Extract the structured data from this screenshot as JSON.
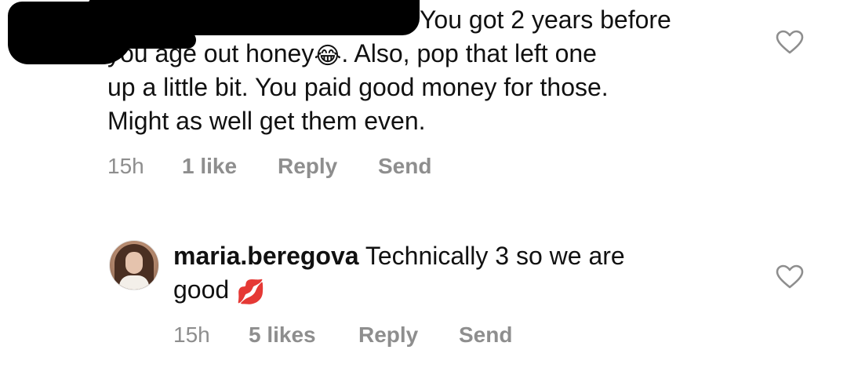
{
  "comments": [
    {
      "username": "",
      "text_line1": "You got 2 years before",
      "text_line2a": "you age out honey",
      "emoji": "😂",
      "text_line2b": ". Also, pop that left one",
      "text_line3": "up a little bit. You paid good money for those.",
      "text_line4": "Might as well get them even.",
      "time": "15h",
      "likes": "1 like",
      "reply_label": "Reply",
      "send_label": "Send",
      "heart_icon": "heart-outline-icon"
    },
    {
      "username": "maria.beregova",
      "text_a": "Technically 3 so we are",
      "text_b": "good",
      "emoji": "💋",
      "time": "15h",
      "likes": "5 likes",
      "reply_label": "Reply",
      "send_label": "Send",
      "heart_icon": "heart-outline-icon"
    }
  ],
  "colors": {
    "text": "#111111",
    "meta": "#8e8e8e",
    "background": "#ffffff",
    "redaction": "#000000"
  }
}
